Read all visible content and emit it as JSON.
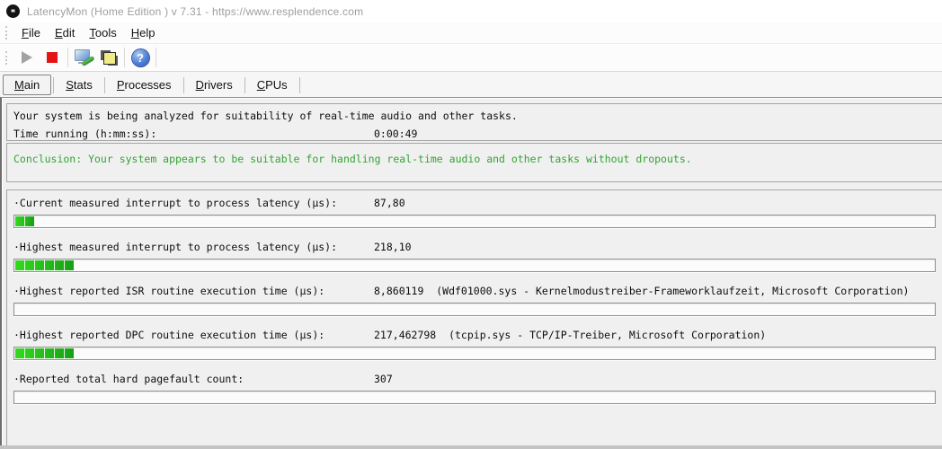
{
  "window": {
    "title": "LatencyMon  (Home Edition )  v 7.31 - https://www.resplendence.com"
  },
  "menu": {
    "items": [
      "File",
      "Edit",
      "Tools",
      "Help"
    ]
  },
  "toolbar": {
    "icons": [
      "play-icon",
      "stop-icon",
      "analyze-monitor-icon",
      "copy-report-icon",
      "help-icon"
    ]
  },
  "tabs": {
    "items": [
      "Main",
      "Stats",
      "Processes",
      "Drivers",
      "CPUs"
    ],
    "active": "Main"
  },
  "analysis": {
    "line1": "Your system is being analyzed for suitability of real-time audio and other tasks.",
    "time_label": "Time running (h:mm:ss):",
    "time_value": "0:00:49"
  },
  "conclusion": {
    "text": "Conclusion: Your system appears to be suitable for handling real-time audio and other tasks without dropouts.",
    "color": "#33a333"
  },
  "measurements": {
    "bar_green_start": "#35da1f",
    "bar_green_end": "#17a017",
    "rows": [
      {
        "label": "·Current measured interrupt to process latency (µs):",
        "value": "87,80",
        "bar_blocks": 2
      },
      {
        "label": "·Highest measured interrupt to process latency (µs):",
        "value": "218,10",
        "bar_blocks": 6
      },
      {
        "label": "·Highest reported ISR routine execution time (µs):",
        "value": "8,860119  (Wdf01000.sys - Kernelmodustreiber-Frameworklaufzeit, Microsoft Corporation)",
        "bar_blocks": 0
      },
      {
        "label": "·Highest reported DPC routine execution time (µs):",
        "value": "217,462798  (tcpip.sys - TCP/IP-Treiber, Microsoft Corporation)",
        "bar_blocks": 6
      },
      {
        "label": "·Reported total hard pagefault count:",
        "value": "307",
        "bar_blocks": 0
      }
    ]
  }
}
